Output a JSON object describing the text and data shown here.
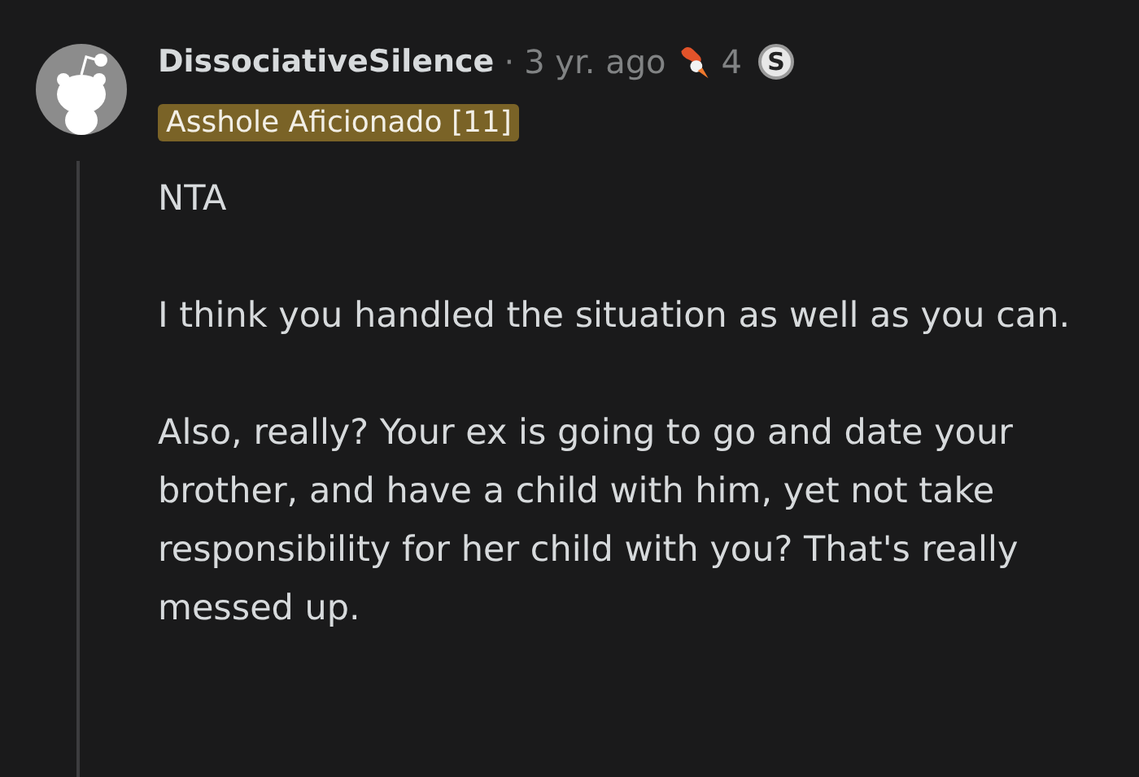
{
  "comment": {
    "author": "DissociativeSilence",
    "separator": "·",
    "age": "3 yr. ago",
    "award_count": "4",
    "award_badge": "S",
    "flair": "Asshole Aficionado [11]",
    "paragraphs": [
      "NTA",
      "I think you handled the situation as well as you can.",
      "Also, really? Your ex is going to go and date your brother, and have a child with him, yet not take responsibility for her child with you? That's really messed up."
    ]
  }
}
